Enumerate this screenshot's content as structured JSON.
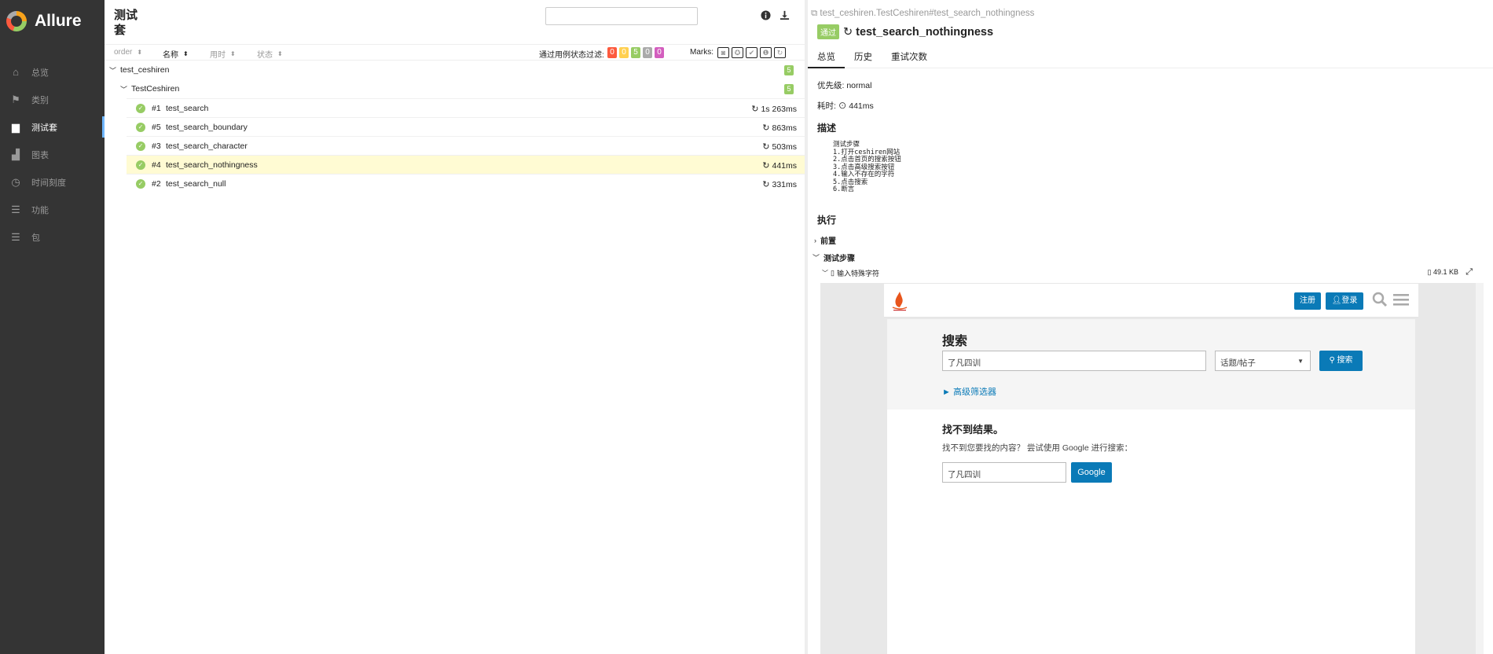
{
  "app": {
    "name": "Allure"
  },
  "sidebar": {
    "items": [
      {
        "icon": "home-icon",
        "glyph": "⌂",
        "label": "总览"
      },
      {
        "icon": "flag-icon",
        "glyph": "⚑",
        "label": "类别"
      },
      {
        "icon": "briefcase-icon",
        "glyph": "▆",
        "label": "测试套"
      },
      {
        "icon": "bar-chart-icon",
        "glyph": "▟",
        "label": "图表"
      },
      {
        "icon": "clock-icon",
        "glyph": "◷",
        "label": "时间刻度"
      },
      {
        "icon": "list-icon",
        "glyph": "☰",
        "label": "功能"
      },
      {
        "icon": "package-icon",
        "glyph": "☰",
        "label": "包"
      }
    ],
    "active_index": 2
  },
  "suites": {
    "title": "测试套",
    "search_placeholder": "",
    "sort": {
      "order": "order",
      "name": "名称",
      "duration": "用时",
      "status": "状态"
    },
    "filter_label": "通过用例状态过滤:",
    "status_counts": [
      {
        "label": "0",
        "color": "#fd5a3e"
      },
      {
        "label": "0",
        "color": "#ffd050"
      },
      {
        "label": "5",
        "color": "#97cc64"
      },
      {
        "label": "0",
        "color": "#aaaaaa"
      },
      {
        "label": "0",
        "color": "#d35ebe"
      }
    ],
    "marks_label": "Marks:",
    "marks": [
      "◙",
      "✪",
      "✔",
      "❶",
      "↻"
    ],
    "tree": {
      "suite": {
        "name": "test_ceshiren",
        "count": "5"
      },
      "class": {
        "name": "TestCeshiren",
        "count": "5"
      },
      "cases": [
        {
          "num": "#1",
          "name": "test_search",
          "duration": "1s 263ms",
          "selected": false
        },
        {
          "num": "#5",
          "name": "test_search_boundary",
          "duration": "863ms",
          "selected": false
        },
        {
          "num": "#3",
          "name": "test_search_character",
          "duration": "503ms",
          "selected": false
        },
        {
          "num": "#4",
          "name": "test_search_nothingness",
          "duration": "441ms",
          "selected": true
        },
        {
          "num": "#2",
          "name": "test_search_null",
          "duration": "331ms",
          "selected": false
        }
      ]
    }
  },
  "detail": {
    "path": "test_ceshiren.TestCeshiren#test_search_nothingness",
    "status": "通过",
    "title": "test_search_nothingness",
    "tabs": [
      "总览",
      "历史",
      "重试次数"
    ],
    "severity": "优先级: normal",
    "duration": "耗时: ⊙ 441ms",
    "description_heading": "描述",
    "description_lines": [
      "测试步骤",
      "1.打开ceshiren网站",
      "2.点击首页的搜索按钮",
      "3.点击高级搜索按钮",
      "4.输入不存在的字符",
      "5.点击搜索",
      "6.断言"
    ],
    "execution_heading": "执行",
    "setup_label": "前置",
    "steps_label": "测试步骤",
    "attachment": {
      "name": "输入特殊字符",
      "size": "49.1 KB"
    }
  },
  "screenshot": {
    "register_btn": "注册",
    "login_btn": "登录",
    "search_title": "搜索",
    "search_value": "了凡四训",
    "scope_value": "话题/帖子",
    "search_btn": "搜索",
    "advanced_filter": "► 高级筛选器",
    "no_result_title": "找不到结果。",
    "no_result_text": "找不到您要找的内容？ 尝试使用 Google 进行搜索：",
    "google_value": "了凡四训",
    "google_btn": "Google"
  }
}
